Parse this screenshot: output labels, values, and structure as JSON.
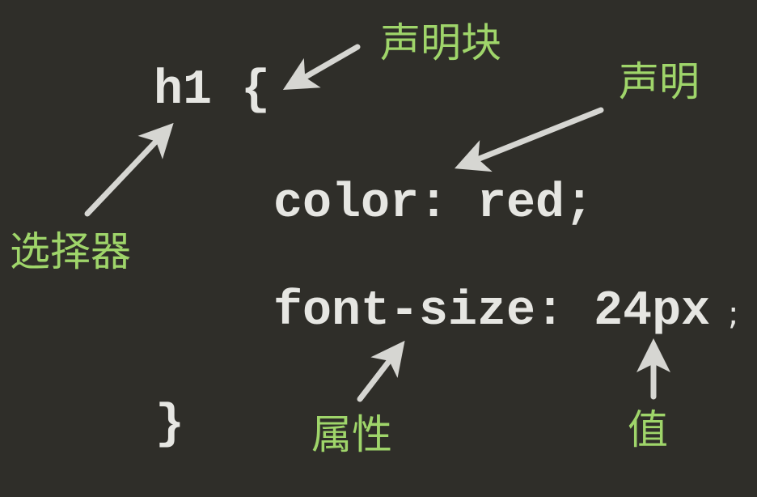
{
  "code": {
    "selector_line": "h1 {",
    "declaration_1": "color: red;",
    "declaration_2": "font-size: 24px",
    "declaration_2_end": ";",
    "closing_brace": "}"
  },
  "labels": {
    "declaration_block": "声明块",
    "declaration": "声明",
    "selector": "选择器",
    "property": "属性",
    "value": "值"
  },
  "colors": {
    "background": "#2f2e29",
    "code_text": "#e6e6e2",
    "label_text": "#9fd56a",
    "arrow": "#d6d6d2"
  }
}
